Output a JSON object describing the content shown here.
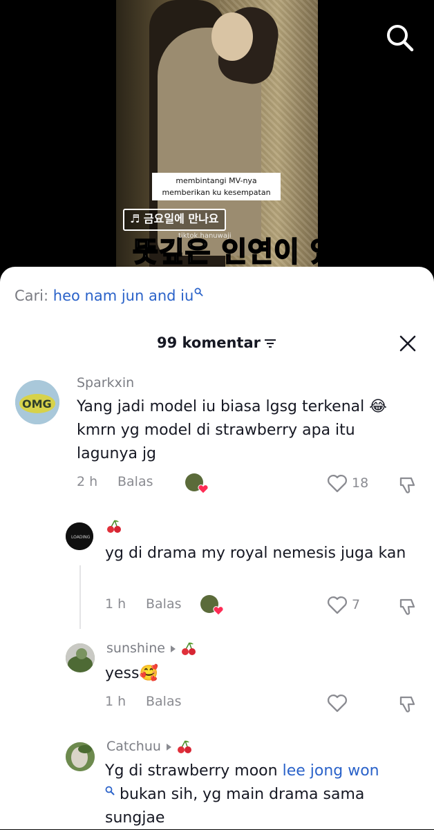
{
  "video": {
    "caption_line1": "membintangi MV-nya",
    "caption_line2": "memberikan ku kesempatan",
    "song_tag": "♬ 금요일에 만나요",
    "big_caption_a": "뜻깊은 ",
    "big_caption_b": "인연",
    "big_caption_c": "이 있",
    "watermark": "tiktok.hanuwaji"
  },
  "search_bar": {
    "label": "Cari:",
    "query": "heo nam jun and iu"
  },
  "header": {
    "count_title": "99 komentar"
  },
  "comments": [
    {
      "username": "Sparkxin",
      "text": "Yang jadi model iu biasa lgsg terkenal 😂 kmrn yg model di strawberry apa itu lagunya jg",
      "time": "2 h",
      "reply_label": "Balas",
      "likes": "18"
    },
    {
      "username": "",
      "text": "yg di drama my royal nemesis juga kan",
      "time": "1 h",
      "reply_label": "Balas",
      "likes": "7"
    },
    {
      "username": "sunshine",
      "text": "yess🥰",
      "time": "1 h",
      "reply_label": "Balas",
      "likes": ""
    },
    {
      "username": "Catchuu",
      "text_before": "Yg di strawberry moon ",
      "link": "lee jong won",
      "text_after": " bukan sih, yg main drama sama sungjae"
    }
  ],
  "colors": {
    "link": "#2a62c9",
    "muted": "#8a8b91",
    "like_heart": "#fe2c55"
  },
  "icons": [
    "search-icon",
    "sort-icon",
    "close-icon",
    "heart-icon",
    "dislike-icon",
    "cherry-icon"
  ]
}
